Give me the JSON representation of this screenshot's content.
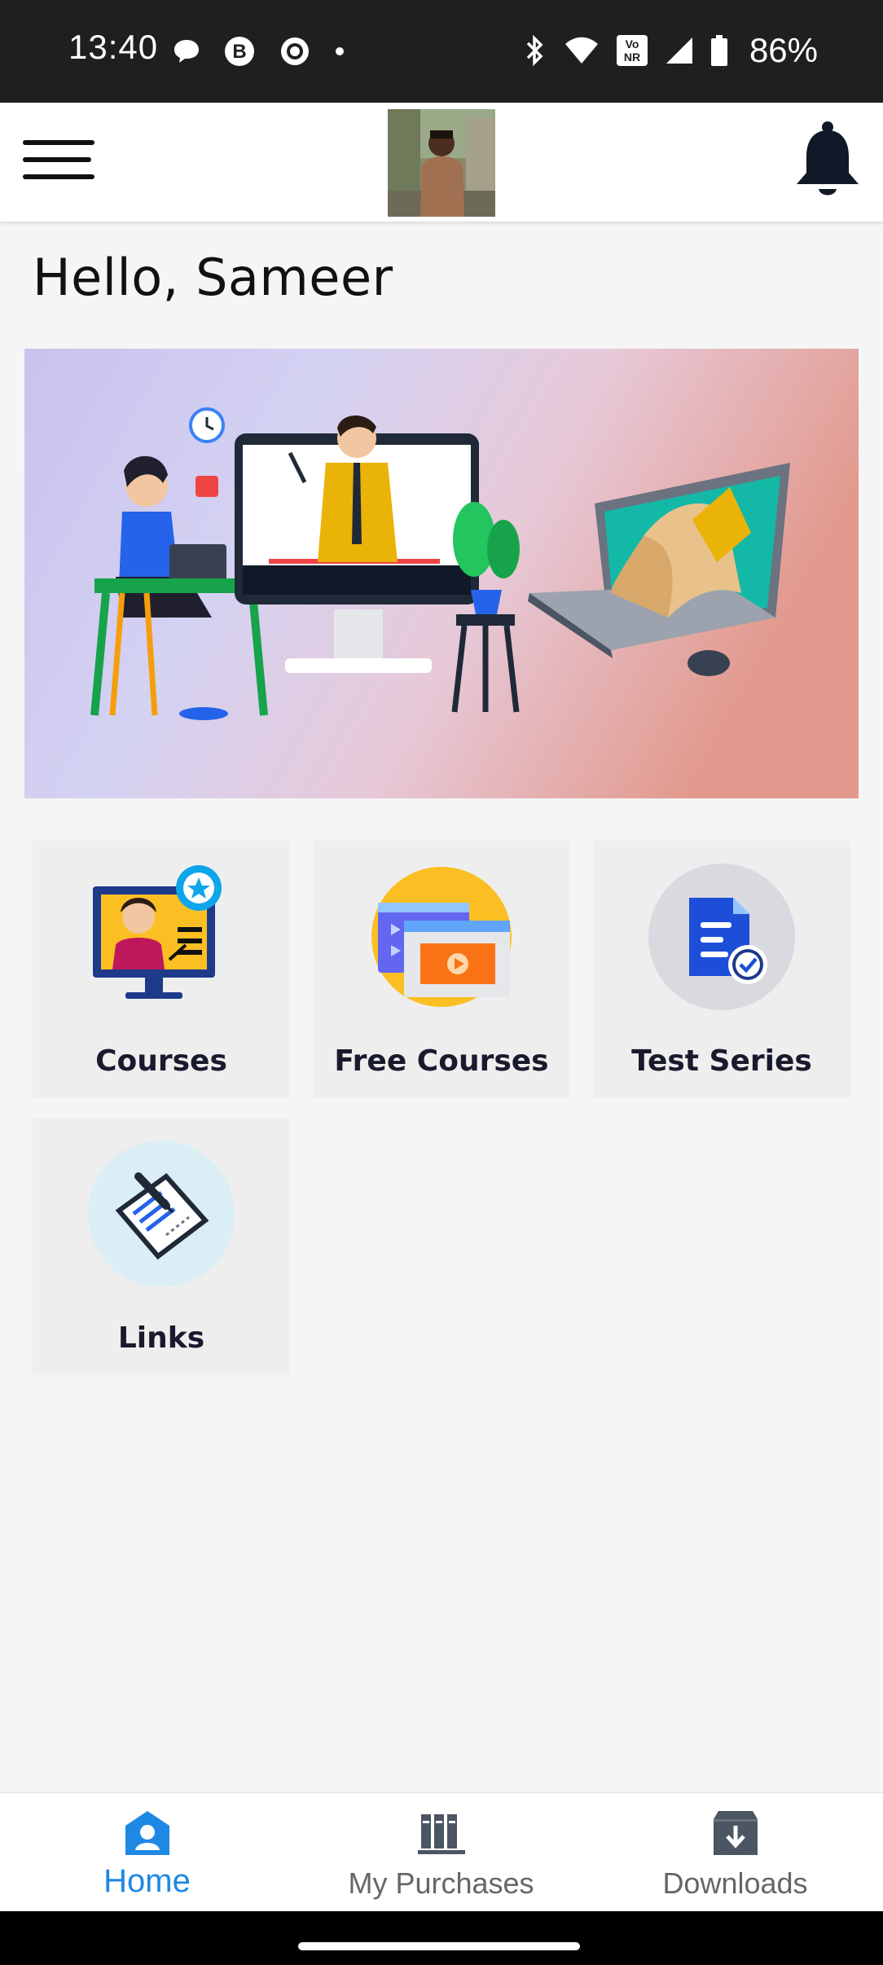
{
  "status_bar": {
    "time": "13:40",
    "battery": "86%",
    "icons_left": [
      "chat-bubble-icon",
      "b-circle-icon",
      "ring-icon",
      "dot-icon"
    ],
    "icons_right": [
      "bluetooth-icon",
      "wifi-icon",
      "vonr-icon",
      "signal-icon",
      "battery-icon"
    ],
    "vonr_label": "Vo NR"
  },
  "app_bar": {
    "menu_icon": "hamburger-menu-icon",
    "avatar": "profile-avatar",
    "bell_icon": "notification-bell-icon"
  },
  "greeting": "Hello, Sameer",
  "banner": {
    "image": "online-learning-banner-illustration"
  },
  "menu_tiles": [
    {
      "label": "Courses",
      "icon": "courses-icon"
    },
    {
      "label": "Free Courses",
      "icon": "free-courses-icon"
    },
    {
      "label": "Test Series",
      "icon": "test-series-icon"
    },
    {
      "label": "Links",
      "icon": "links-icon"
    }
  ],
  "bottom_nav": {
    "items": [
      {
        "label": "Home",
        "icon": "home-icon",
        "active": true
      },
      {
        "label": "My Purchases",
        "icon": "books-icon",
        "active": false
      },
      {
        "label": "Downloads",
        "icon": "download-box-icon",
        "active": false
      }
    ]
  },
  "colors": {
    "accent": "#1e88e5",
    "status_bar": "#1f1f1f",
    "background": "#f5f5f5",
    "tile_background": "#eeeeee",
    "inactive_nav": "#666666"
  }
}
